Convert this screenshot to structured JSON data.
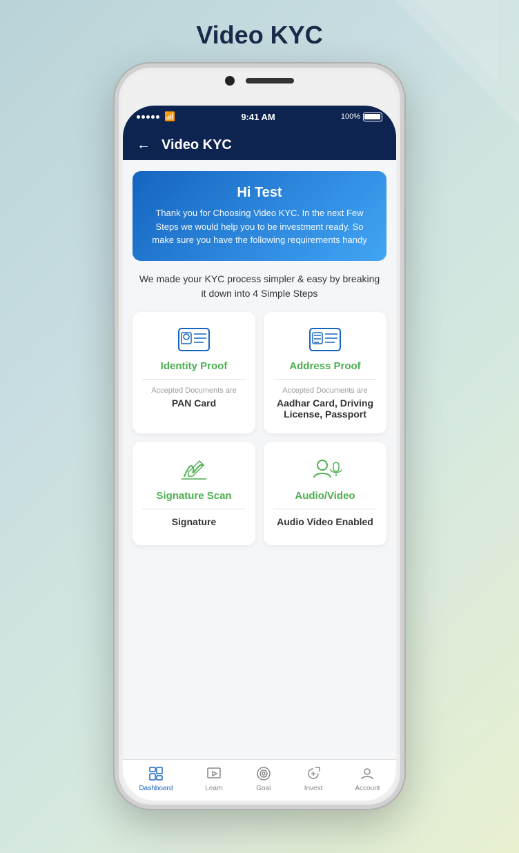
{
  "page": {
    "title": "Video KYC"
  },
  "statusBar": {
    "time": "9:41 AM",
    "battery": "100%"
  },
  "navBar": {
    "title": "Video KYC",
    "backLabel": "←"
  },
  "banner": {
    "greeting": "Hi Test",
    "description": "Thank you for Choosing Video KYC. In the next Few Steps we would help you to be investment ready. So make sure you have the following requirements handy"
  },
  "stepsDesc": "We made your KYC process simpler & easy by breaking it down into 4 Simple Steps",
  "cards": [
    {
      "id": "identity",
      "title": "Identity Proof",
      "docLabel": "Accepted Documents are",
      "docValue": "PAN Card"
    },
    {
      "id": "address",
      "title": "Address Proof",
      "docLabel": "Accepted Documents are",
      "docValue": "Aadhar Card, Driving License, Passport"
    },
    {
      "id": "signature",
      "title": "Signature Scan",
      "docLabel": "",
      "docValue": "Signature"
    },
    {
      "id": "audiovideo",
      "title": "Audio/Video",
      "docLabel": "",
      "docValue": "Audio Video Enabled"
    }
  ],
  "tabBar": {
    "items": [
      {
        "id": "dashboard",
        "label": "Dashboard",
        "active": true
      },
      {
        "id": "learn",
        "label": "Learn",
        "active": false
      },
      {
        "id": "goal",
        "label": "Goal",
        "active": false
      },
      {
        "id": "invest",
        "label": "Invest",
        "active": false
      },
      {
        "id": "account",
        "label": "Account",
        "active": false
      }
    ]
  }
}
